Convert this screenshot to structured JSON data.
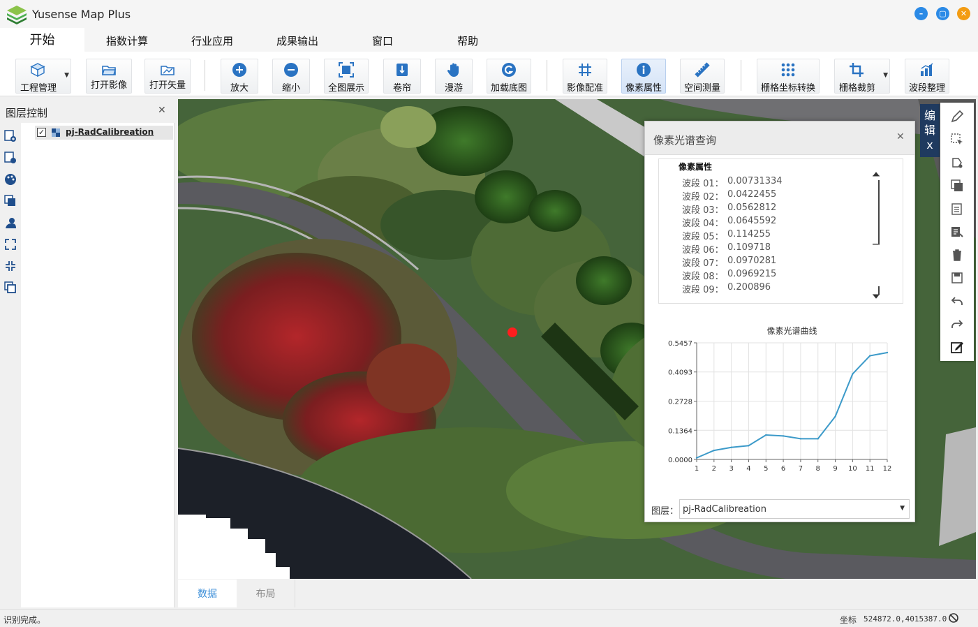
{
  "app": {
    "title": "Yusense Map Plus"
  },
  "menu": {
    "tabs": [
      {
        "label": "开始",
        "active": true
      },
      {
        "label": "指数计算"
      },
      {
        "label": "行业应用"
      },
      {
        "label": "成果输出"
      },
      {
        "label": "窗口"
      },
      {
        "label": "帮助"
      }
    ]
  },
  "toolbar": {
    "items": [
      {
        "label": "工程管理",
        "icon": "cube-icon"
      },
      {
        "label": "打开影像",
        "icon": "folder-open-icon"
      },
      {
        "label": "打开矢量",
        "icon": "folder-vector-icon"
      },
      {
        "label": "放大",
        "icon": "zoom-in-icon"
      },
      {
        "label": "缩小",
        "icon": "zoom-out-icon"
      },
      {
        "label": "全图展示",
        "icon": "full-extent-icon"
      },
      {
        "label": "卷帘",
        "icon": "swipe-icon"
      },
      {
        "label": "漫游",
        "icon": "hand-icon"
      },
      {
        "label": "加载底图",
        "icon": "basemap-icon"
      },
      {
        "label": "影像配准",
        "icon": "grid-register-icon"
      },
      {
        "label": "像素属性",
        "icon": "info-icon",
        "active": true
      },
      {
        "label": "空间测量",
        "icon": "ruler-icon"
      },
      {
        "label": "栅格坐标转换",
        "icon": "dots-grid-icon"
      },
      {
        "label": "栅格裁剪",
        "icon": "crop-icon"
      },
      {
        "label": "波段整理",
        "icon": "bar-chart-icon"
      }
    ]
  },
  "layer_panel": {
    "title": "图层控制",
    "layer_name": "pj-RadCalibreation"
  },
  "pixel_dialog": {
    "title": "像素光谱查询",
    "section_title": "像素属性",
    "bands": [
      {
        "label": "波段 01：",
        "value": "0.00731334"
      },
      {
        "label": "波段 02：",
        "value": "0.0422455"
      },
      {
        "label": "波段 03：",
        "value": "0.0562812"
      },
      {
        "label": "波段 04：",
        "value": "0.0645592"
      },
      {
        "label": "波段 05：",
        "value": "0.114255"
      },
      {
        "label": "波段 06：",
        "value": "0.109718"
      },
      {
        "label": "波段 07：",
        "value": "0.0970281"
      },
      {
        "label": "波段 08：",
        "value": "0.0969215"
      },
      {
        "label": "波段 09：",
        "value": "0.200896"
      }
    ],
    "layer_label": "图层：",
    "layer_value": "pj-RadCalibreation"
  },
  "chart_data": {
    "type": "line",
    "title": "像素光谱曲线",
    "xlabel": "",
    "ylabel": "",
    "x": [
      1,
      2,
      3,
      4,
      5,
      6,
      7,
      8,
      9,
      10,
      11,
      12
    ],
    "y": [
      0.0073,
      0.0422,
      0.0563,
      0.0646,
      0.1143,
      0.1097,
      0.097,
      0.0969,
      0.2009,
      0.4,
      0.485,
      0.5
    ],
    "yticks": [
      "0.0000",
      "0.1364",
      "0.2728",
      "0.4093",
      "0.5457"
    ],
    "ylim": [
      0,
      0.5457
    ],
    "xlim": [
      1,
      12
    ],
    "grid": true,
    "color": "#3c9ac9"
  },
  "edit_panel": {
    "tab_chars": [
      "编",
      "辑",
      "x"
    ]
  },
  "bottom_tabs": [
    {
      "label": "数据",
      "active": true
    },
    {
      "label": "布局"
    }
  ],
  "status": {
    "text": "识别完成。",
    "coord_label": "坐标",
    "coord_value": "524872.0,4015387.0"
  }
}
